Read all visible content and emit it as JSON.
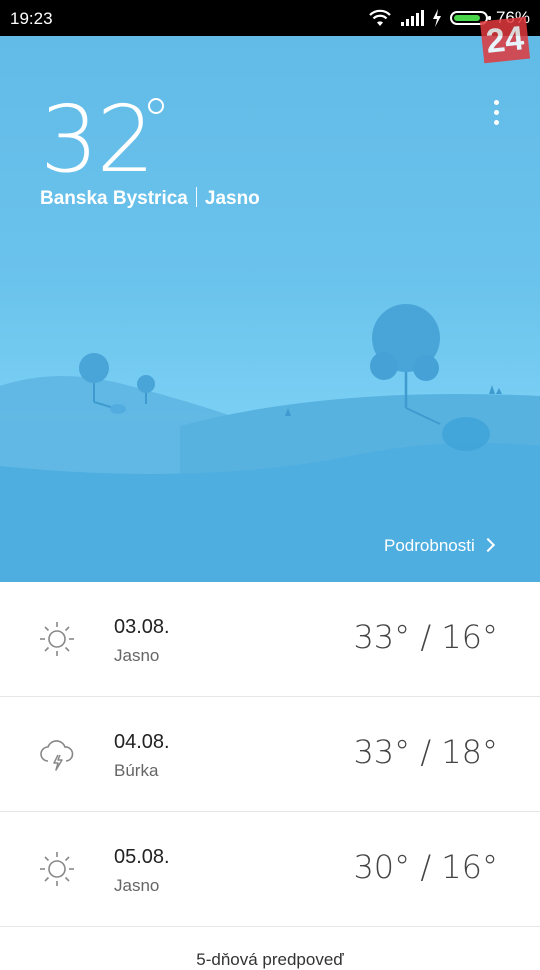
{
  "status_bar": {
    "time": "19:23",
    "battery_percent": "76%",
    "battery_level": 0.76,
    "battery_color": "#49d64b",
    "icons": [
      "wifi-icon",
      "signal-icon",
      "charging-icon",
      "battery-icon"
    ]
  },
  "watermark": {
    "text": "24",
    "color": "#e0393d"
  },
  "current": {
    "temperature": "32",
    "city": "Banska Bystrica",
    "condition": "Jasno"
  },
  "hero": {
    "details_label": "Podrobnosti",
    "sky_color": "#62bbe7"
  },
  "forecast": [
    {
      "date": "03.08.",
      "condition": "Jasno",
      "range": "33° / 16°",
      "icon": "sun-icon"
    },
    {
      "date": "04.08.",
      "condition": "Búrka",
      "range": "33° / 18°",
      "icon": "thunderstorm-icon"
    },
    {
      "date": "05.08.",
      "condition": "Jasno",
      "range": "30° / 16°",
      "icon": "sun-icon"
    }
  ],
  "footer": {
    "partial_text": "5-dňová predpoveď"
  }
}
